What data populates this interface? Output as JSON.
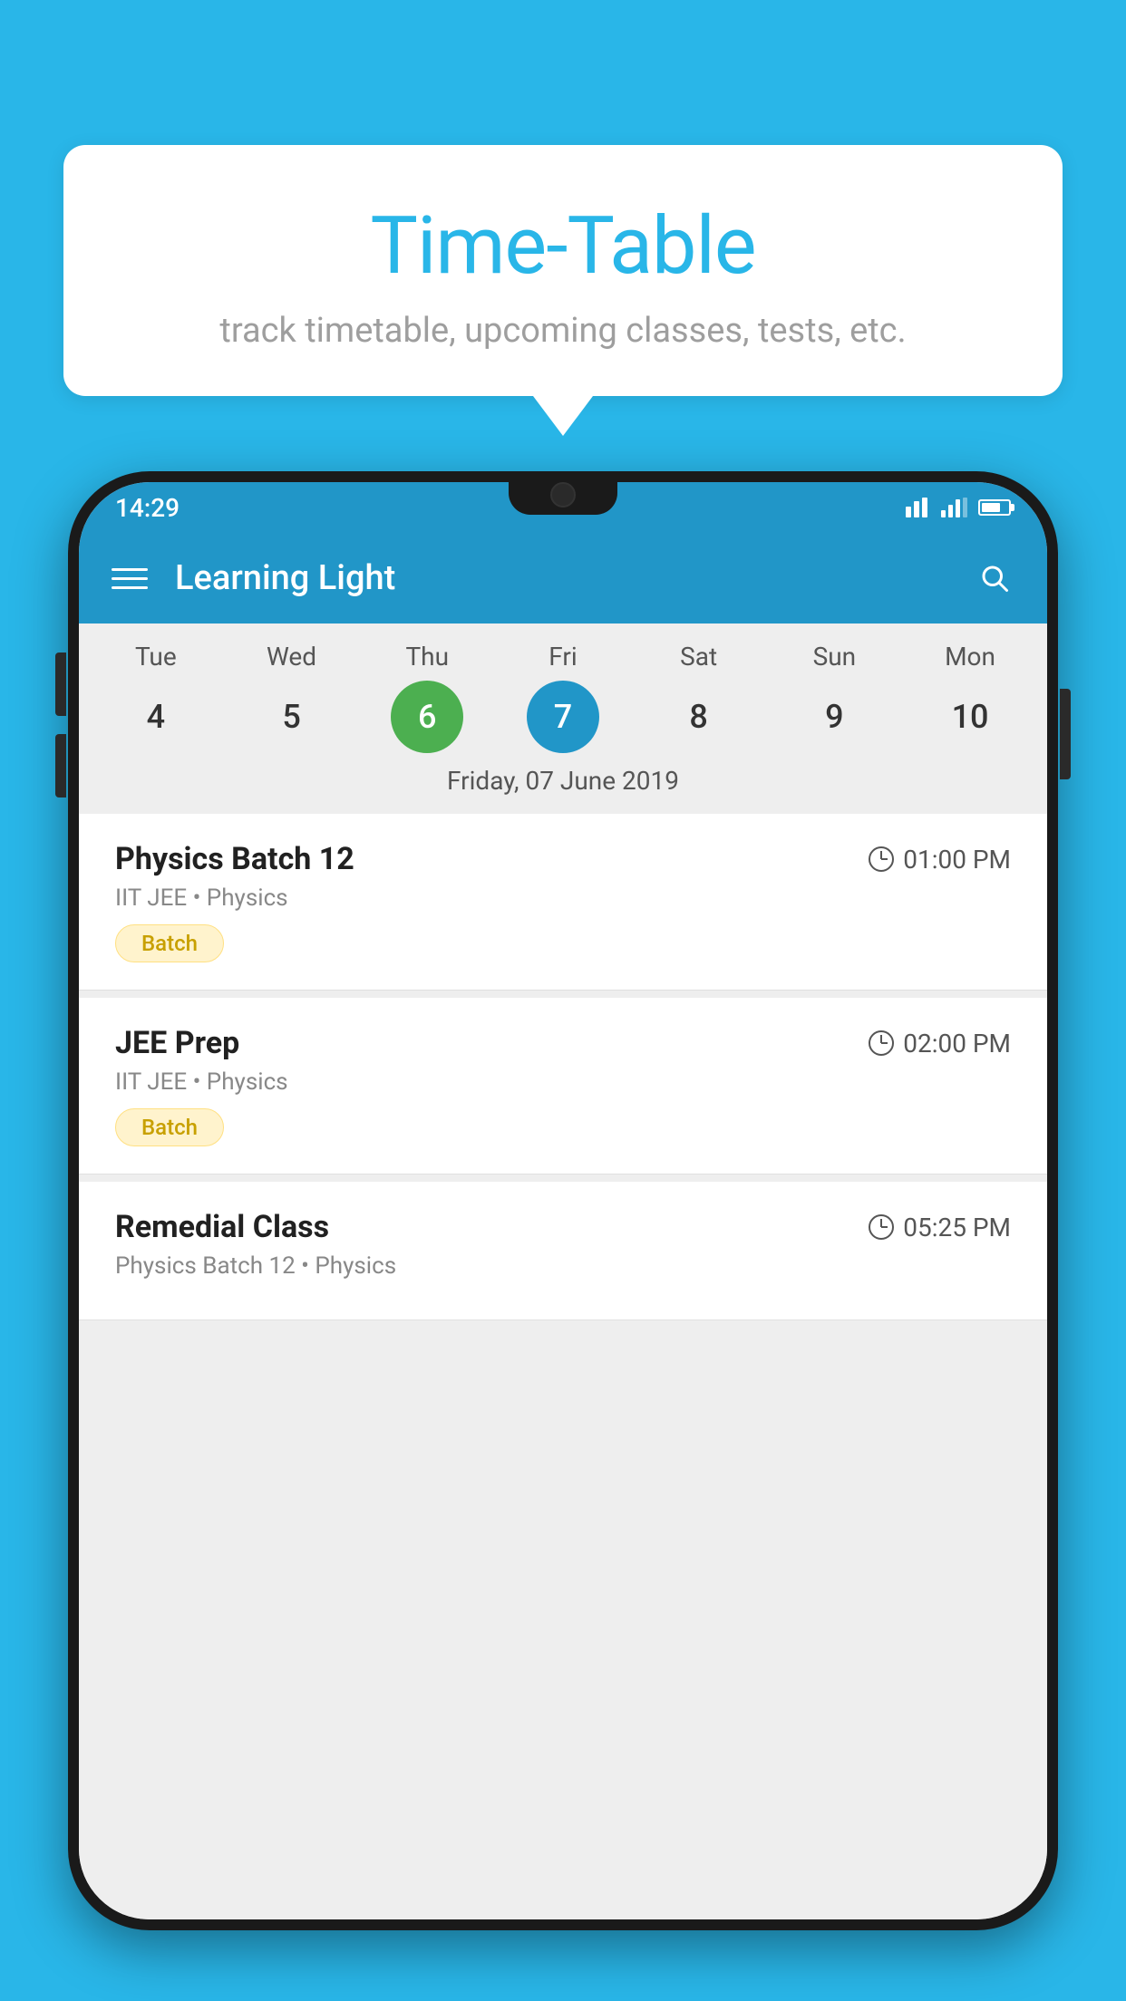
{
  "background_color": "#29B6E8",
  "tooltip": {
    "title": "Time-Table",
    "subtitle": "track timetable, upcoming classes, tests, etc."
  },
  "phone": {
    "status_bar": {
      "time": "14:29"
    },
    "app_bar": {
      "title": "Learning Light"
    },
    "calendar": {
      "days": [
        "Tue",
        "Wed",
        "Thu",
        "Fri",
        "Sat",
        "Sun",
        "Mon"
      ],
      "dates": [
        "4",
        "5",
        "6",
        "7",
        "8",
        "9",
        "10"
      ],
      "today_index": 2,
      "selected_index": 3,
      "selected_label": "Friday, 07 June 2019"
    },
    "schedule": [
      {
        "title": "Physics Batch 12",
        "time": "01:00 PM",
        "meta": "IIT JEE • Physics",
        "badge": "Batch"
      },
      {
        "title": "JEE Prep",
        "time": "02:00 PM",
        "meta": "IIT JEE • Physics",
        "badge": "Batch"
      },
      {
        "title": "Remedial Class",
        "time": "05:25 PM",
        "meta": "Physics Batch 12 • Physics",
        "badge": ""
      }
    ]
  }
}
